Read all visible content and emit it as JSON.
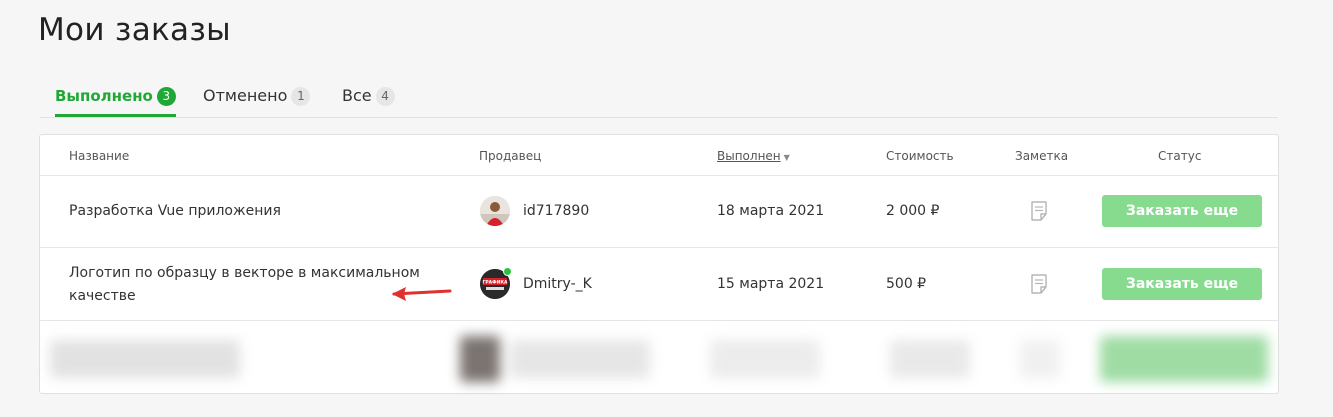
{
  "page_title": "Мои заказы",
  "tabs": [
    {
      "label": "Выполнено",
      "count": "3",
      "active": true
    },
    {
      "label": "Отменено",
      "count": "1",
      "active": false
    },
    {
      "label": "Все",
      "count": "4",
      "active": false
    }
  ],
  "table": {
    "columns": {
      "name": "Название",
      "seller": "Продавец",
      "completed": "Выполнен",
      "price": "Стоимость",
      "note": "Заметка",
      "status": "Статус"
    },
    "rows": [
      {
        "name": "Разработка Vue приложения",
        "seller": "id717890",
        "date": "18 марта 2021",
        "price": "2 000 ₽",
        "action": "Заказать еще"
      },
      {
        "name_line1": "Логотип по образцу в векторе в максимальном",
        "name_line2": "качестве",
        "seller": "Dmitry-_K",
        "date": "15 марта 2021",
        "price": "500 ₽",
        "action": "Заказать еще",
        "avatar_text": "ГРАФИКА"
      }
    ]
  },
  "colors": {
    "accent": "#1fa836",
    "button": "#86db8f",
    "arrow": "#e0312f"
  }
}
